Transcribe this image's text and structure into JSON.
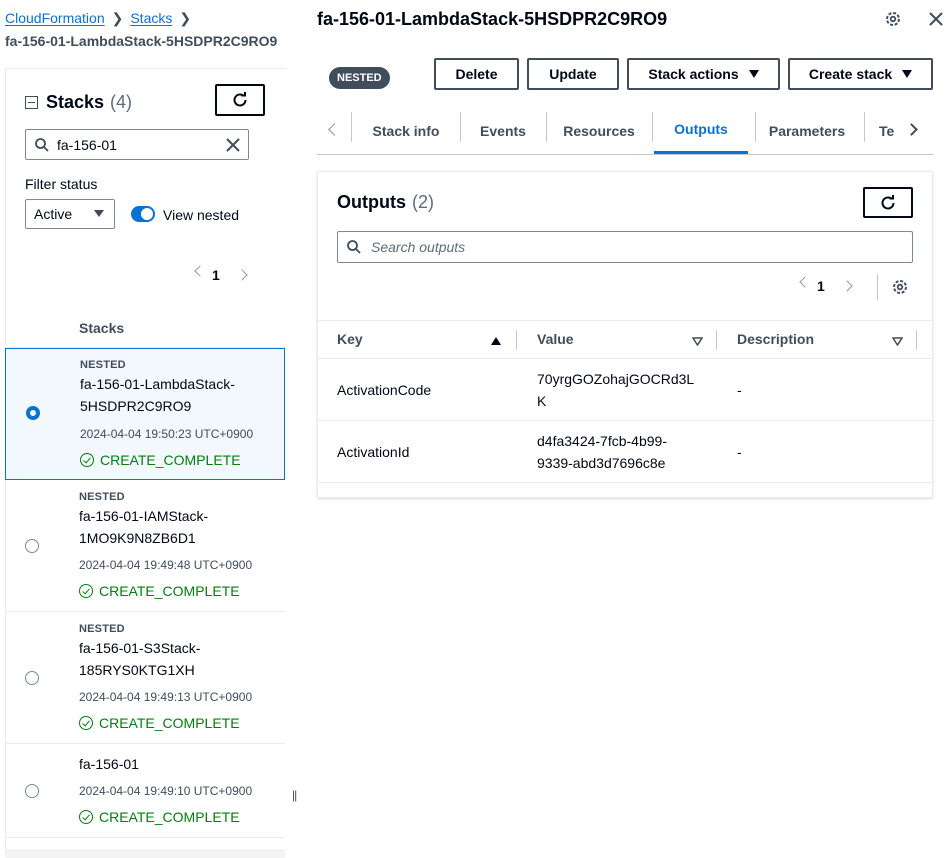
{
  "breadcrumb": {
    "items": [
      "CloudFormation",
      "Stacks"
    ],
    "current": "fa-156-01-LambdaStack-5HSDPR2C9RO9"
  },
  "stacks_panel": {
    "title": "Stacks",
    "count": "(4)",
    "search_value": "fa-156-01",
    "filter_label": "Filter status",
    "filter_value": "Active",
    "view_nested_label": "View nested",
    "view_nested_on": true,
    "page": "1",
    "column_header": "Stacks",
    "rows": [
      {
        "badge": "NESTED",
        "name_line1": "fa-156-01-LambdaStack-",
        "name_line2": "5HSDPR2C9RO9",
        "time": "2024-04-04 19:50:23 UTC+0900",
        "status": "CREATE_COMPLETE",
        "selected": true
      },
      {
        "badge": "NESTED",
        "name_line1": "fa-156-01-IAMStack-",
        "name_line2": "1MO9K9N8ZB6D1",
        "time": "2024-04-04 19:49:48 UTC+0900",
        "status": "CREATE_COMPLETE",
        "selected": false
      },
      {
        "badge": "NESTED",
        "name_line1": "fa-156-01-S3Stack-",
        "name_line2": "185RYS0KTG1XH",
        "time": "2024-04-04 19:49:13 UTC+0900",
        "status": "CREATE_COMPLETE",
        "selected": false
      },
      {
        "badge": "",
        "name_line1": "fa-156-01",
        "name_line2": "",
        "time": "2024-04-04 19:49:10 UTC+0900",
        "status": "CREATE_COMPLETE",
        "selected": false
      }
    ]
  },
  "detail": {
    "title": "fa-156-01-LambdaStack-5HSDPR2C9RO9",
    "nested_badge": "NESTED",
    "buttons": {
      "delete": "Delete",
      "update": "Update",
      "stack_actions": "Stack actions",
      "create_stack": "Create stack"
    },
    "tabs": [
      "Stack info",
      "Events",
      "Resources",
      "Outputs",
      "Parameters",
      "Te"
    ],
    "active_tab": "Outputs"
  },
  "outputs": {
    "title": "Outputs",
    "count": "(2)",
    "search_placeholder": "Search outputs",
    "page": "1",
    "columns": [
      "Key",
      "Value",
      "Description"
    ],
    "rows": [
      {
        "key": "ActivationCode",
        "value_line1": "70yrgGOZohajGOCRd3L",
        "value_line2": "K",
        "description": "-"
      },
      {
        "key": "ActivationId",
        "value_line1": "d4fa3424-7fcb-4b99-",
        "value_line2": "9339-abd3d7696c8e",
        "description": "-"
      }
    ]
  },
  "colors": {
    "accent": "#0972d3",
    "success": "#037f0c",
    "text": "#000716",
    "muted": "#414d5c"
  }
}
